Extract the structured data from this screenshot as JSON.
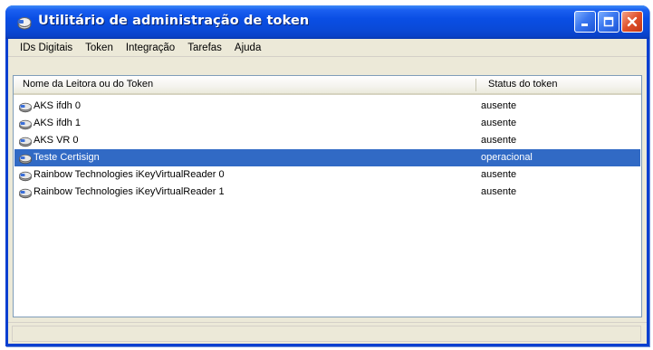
{
  "window": {
    "title": "Utilitário de administração de token",
    "icon": "token-app-icon",
    "controls": {
      "minimize": "minimize-icon",
      "maximize": "maximize-icon",
      "close": "close-icon"
    }
  },
  "menu": {
    "items": [
      {
        "label": "IDs Digitais"
      },
      {
        "label": "Token"
      },
      {
        "label": "Integração"
      },
      {
        "label": "Tarefas"
      },
      {
        "label": "Ajuda"
      }
    ]
  },
  "list": {
    "columns": {
      "name": "Nome da Leitora ou do Token",
      "status": "Status do token"
    },
    "rows": [
      {
        "name": "AKS ifdh 0",
        "status": "ausente",
        "icon": "card-reader-icon",
        "selected": false
      },
      {
        "name": "AKS ifdh 1",
        "status": "ausente",
        "icon": "card-reader-icon",
        "selected": false
      },
      {
        "name": "AKS VR 0",
        "status": "ausente",
        "icon": "card-reader-icon",
        "selected": false
      },
      {
        "name": "Teste Certisign",
        "status": "operacional",
        "icon": "token-icon",
        "selected": true
      },
      {
        "name": "Rainbow Technologies iKeyVirtualReader 0",
        "status": "ausente",
        "icon": "card-reader-icon",
        "selected": false
      },
      {
        "name": "Rainbow Technologies iKeyVirtualReader 1",
        "status": "ausente",
        "icon": "card-reader-icon",
        "selected": false
      }
    ]
  },
  "colors": {
    "titlebar": "#0a4ee4",
    "selection": "#316ac5",
    "window_face": "#ece9d8"
  }
}
